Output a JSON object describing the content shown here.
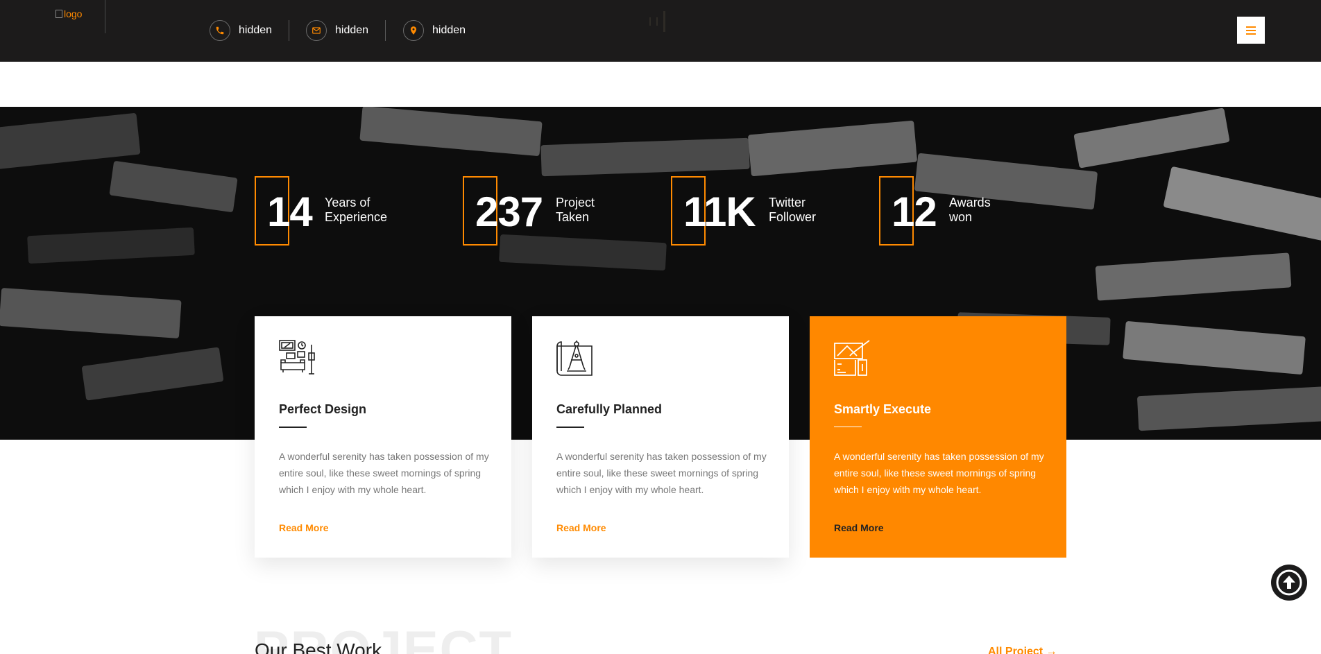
{
  "header": {
    "logo_alt": "logo",
    "contacts": [
      {
        "icon": "phone-icon",
        "label": "hidden"
      },
      {
        "icon": "mail-icon",
        "label": "hidden"
      },
      {
        "icon": "location-icon",
        "label": "hidden"
      }
    ],
    "menu_icon": "hamburger-icon"
  },
  "stats": [
    {
      "number": "14",
      "line1": "Years of",
      "line2": "Experience"
    },
    {
      "number": "237",
      "line1": "Project",
      "line2": "Taken"
    },
    {
      "number": "11K",
      "line1": "Twitter",
      "line2": "Follower"
    },
    {
      "number": "12",
      "line1": "Awards",
      "line2": "won"
    }
  ],
  "features": [
    {
      "icon": "furniture-design-icon",
      "title": "Perfect Design",
      "description": "A wonderful serenity has taken possession of my entire soul, like these sweet mornings of spring which I enjoy with my whole heart.",
      "link": "Read More"
    },
    {
      "icon": "blueprint-compass-icon",
      "title": "Carefully Planned",
      "description": "A wonderful serenity has taken possession of my entire soul, like these sweet mornings of spring which I enjoy with my whole heart.",
      "link": "Read More"
    },
    {
      "icon": "drafting-tools-icon",
      "title": "Smartly Execute",
      "description": "A wonderful serenity has taken possession of my entire soul, like these sweet mornings of spring which I enjoy with my whole heart.",
      "link": "Read More"
    }
  ],
  "project_section": {
    "ghost_text": "PROJECT",
    "title": "Our Best Work",
    "all_link": "All Project →"
  },
  "scroll_top_icon": "arrow-up-circle-icon",
  "colors": {
    "accent": "#ff8800",
    "dark": "#1c1b1b",
    "text": "#222222",
    "muted": "#777777"
  }
}
